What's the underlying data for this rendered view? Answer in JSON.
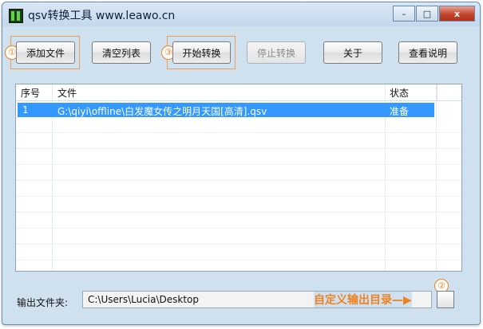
{
  "window": {
    "title": "qsv转换工具 www.leawo.cn",
    "minimize_label": "–",
    "maximize_label": "□",
    "close_label": "x"
  },
  "toolbar": {
    "add_file": "添加文件",
    "clear_list": "清空列表",
    "start_convert": "开始转换",
    "stop_convert": "停止转换",
    "about": "关于",
    "help": "查看说明"
  },
  "markers": {
    "m1": "①",
    "m2": "②",
    "m3": "③"
  },
  "list": {
    "headers": {
      "index": "序号",
      "file": "文件",
      "status": "状态"
    },
    "rows": [
      {
        "index": "1",
        "file": "G:\\qiyi\\offline\\白发魔女传之明月天国[高清].qsv",
        "status": "准备",
        "selected": true
      }
    ]
  },
  "output": {
    "label": "输出文件夹:",
    "path": "C:\\Users\\Lucia\\Desktop",
    "annotation": "自定义输出目录—▶"
  },
  "colors": {
    "accent": "#f0821e",
    "selection": "#3399ff",
    "window_bg": "#cfe0ef"
  }
}
